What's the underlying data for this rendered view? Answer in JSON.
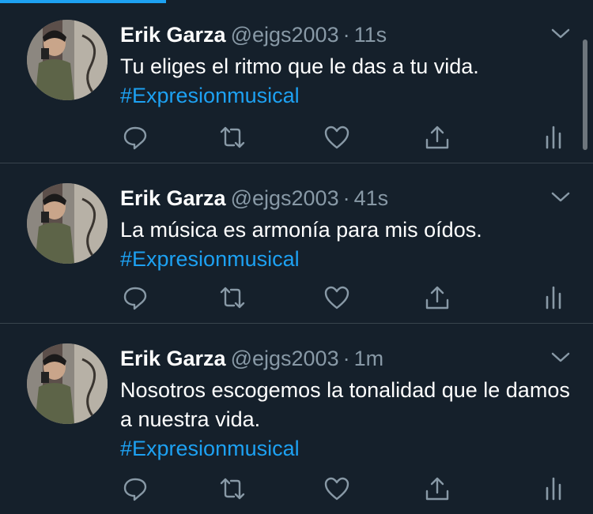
{
  "tweets": [
    {
      "name": "Erik Garza",
      "handle": "@ejgs2003",
      "separator": "·",
      "time": "11s",
      "text": "Tu eliges el ritmo que le das a tu vida.",
      "hashtag": "#Expresionmusical"
    },
    {
      "name": "Erik Garza",
      "handle": "@ejgs2003",
      "separator": "·",
      "time": "41s",
      "text": "La música es armonía para mis oídos.",
      "hashtag": "#Expresionmusical"
    },
    {
      "name": "Erik Garza",
      "handle": "@ejgs2003",
      "separator": "·",
      "time": "1m",
      "text": "Nosotros escogemos la tonalidad que le damos a nuestra vida.",
      "hashtag": "#Expresionmusical"
    }
  ],
  "icons": [
    "reply-icon",
    "retweet-icon",
    "like-icon",
    "share-icon",
    "analytics-icon",
    "chevron-down-icon"
  ],
  "colors": {
    "background": "#15202b",
    "divider": "#38444d",
    "secondary_text": "#8899a6",
    "accent": "#1da1f2"
  }
}
